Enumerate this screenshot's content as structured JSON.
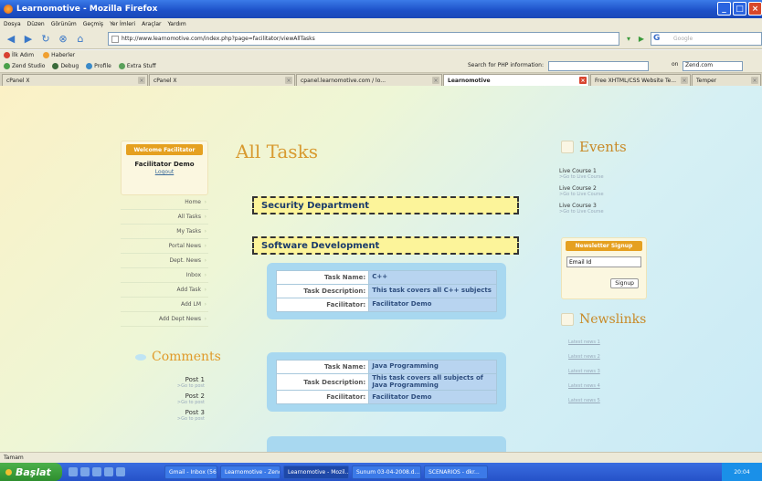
{
  "window": {
    "title": "Learnomotive - Mozilla Firefox"
  },
  "menu": [
    "Dosya",
    "Düzen",
    "Görünüm",
    "Geçmiş",
    "Yer İmleri",
    "Araçlar",
    "Yardım"
  ],
  "nav": {
    "url": "http://www.learnomotive.com/index.php?page=facilitator/viewAllTasks",
    "search_placeholder": "Google"
  },
  "bookmarks": [
    "İlk Adım",
    "Haberler"
  ],
  "toolbar2": {
    "items": [
      "Zend Studio",
      "Debug",
      "Profile",
      "Extra Stuff"
    ],
    "php_label": "Search for PHP information:",
    "on_label": "on",
    "zend_value": "Zend.com"
  },
  "tabs": [
    {
      "label": "cPanel X"
    },
    {
      "label": "cPanel X"
    },
    {
      "label": "cpanel.learnomotive.com / lo..."
    },
    {
      "label": "Learnomotive"
    },
    {
      "label": "Free XHTML/CSS Website Te..."
    },
    {
      "label": "Temper"
    }
  ],
  "sidebar": {
    "welcome_header": "Welcome Facilitator",
    "user_name": "Facilitator Demo",
    "logout": "Logout",
    "items": [
      "Home",
      "All Tasks",
      "My Tasks",
      "Portal News",
      "Dept. News",
      "Inbox",
      "Add Task",
      "Add LM",
      "Add Dept News"
    ],
    "comments_title": "Comments",
    "posts": [
      {
        "title": "Post 1",
        "link": ">Go to post"
      },
      {
        "title": "Post 2",
        "link": ">Go to post"
      },
      {
        "title": "Post 3",
        "link": ">Go to post"
      }
    ]
  },
  "main": {
    "title": "All Tasks",
    "departments": [
      "Security Department",
      "Software Development"
    ],
    "labels": {
      "task_name": "Task Name:",
      "task_desc": "Task Description:",
      "facilitator": "Facilitator:"
    },
    "tasks": [
      {
        "name": "C++",
        "desc": "This task covers all C++ subjects",
        "facilitator": "Facilitator Demo"
      },
      {
        "name": "Java Programming",
        "desc": "This task covers all subjects of Java Programming",
        "facilitator": "Facilitator Demo"
      }
    ]
  },
  "right": {
    "events_title": "Events",
    "events": [
      {
        "title": "Live Course 1",
        "link": ">Go to Live Course"
      },
      {
        "title": "Live Course 2",
        "link": ">Go to Live Course"
      },
      {
        "title": "Live Course 3",
        "link": ">Go to Live Course"
      }
    ],
    "newsletter_header": "Newsletter Signup",
    "email_value": "Email Id",
    "signup_label": "Signup",
    "newslinks_title": "Newslinks",
    "newslinks": [
      "Latest news 1",
      "Latest news 2",
      "Latest news 3",
      "Latest news 4",
      "Latest news 5"
    ]
  },
  "status": "Tamam",
  "taskbar": {
    "start": "Başlat",
    "tasks": [
      "Gmail - Inbox (567)...",
      "Learnomotive - Zend...",
      "Learnomotive - Mozil...",
      "Sunum 03-04-2008.d...",
      "SCENARIOS - dkr..."
    ],
    "clock": "20:04"
  }
}
